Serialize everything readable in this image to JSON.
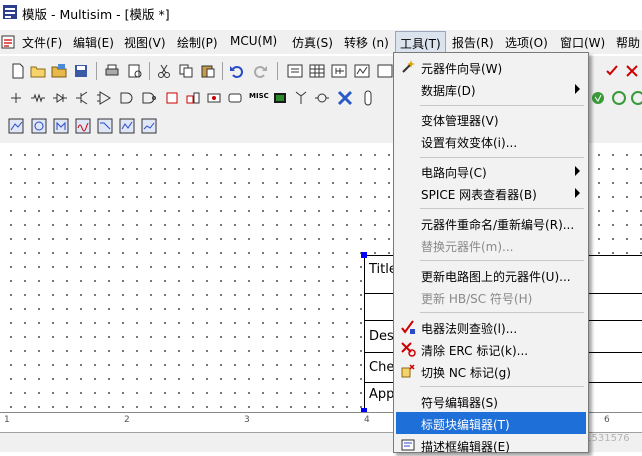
{
  "window": {
    "title": "模版 - Multisim - [模版 *]"
  },
  "menubar": {
    "items": [
      {
        "label": "文件(F)",
        "active": false
      },
      {
        "label": "编辑(E)",
        "active": false
      },
      {
        "label": "视图(V)",
        "active": false
      },
      {
        "label": "绘制(P)",
        "active": false
      },
      {
        "label": "MCU(M)",
        "active": false
      },
      {
        "label": "仿真(S)",
        "active": false
      },
      {
        "label": "转移 (n)",
        "active": false
      },
      {
        "label": "工具(T)",
        "active": true
      },
      {
        "label": "报告(R)",
        "active": false
      },
      {
        "label": "选项(O)",
        "active": false
      },
      {
        "label": "窗口(W)",
        "active": false
      },
      {
        "label": "帮助",
        "active": false
      }
    ]
  },
  "toolbar": {
    "misc_label": "MISC"
  },
  "tools_menu": {
    "items": [
      {
        "label": "元器件向导(W)",
        "disabled": false,
        "submenu": false,
        "icon": "component-wizard-icon"
      },
      {
        "label": "数据库(D)",
        "disabled": false,
        "submenu": true
      },
      {
        "label": "变体管理器(V)",
        "disabled": false,
        "submenu": false
      },
      {
        "label": "设置有效变体(i)...",
        "disabled": false,
        "submenu": false
      },
      {
        "label": "电路向导(C)",
        "disabled": false,
        "submenu": true
      },
      {
        "label": "SPICE 网表查看器(B)",
        "disabled": false,
        "submenu": true
      },
      {
        "label": "元器件重命名/重新编号(R)...",
        "disabled": false,
        "submenu": false
      },
      {
        "label": "替换元器件(m)...",
        "disabled": true,
        "submenu": false
      },
      {
        "label": "更新电路图上的元器件(U)...",
        "disabled": false,
        "submenu": false
      },
      {
        "label": "更新 HB/SC 符号(H)",
        "disabled": true,
        "submenu": false
      },
      {
        "label": "电器法则查验(l)...",
        "disabled": false,
        "submenu": false,
        "icon": "erc-check-icon"
      },
      {
        "label": "清除 ERC 标记(k)...",
        "disabled": false,
        "submenu": false,
        "icon": "clear-erc-icon"
      },
      {
        "label": "切换 NC 标记(g)",
        "disabled": false,
        "submenu": false,
        "icon": "toggle-nc-icon"
      },
      {
        "label": "符号编辑器(S)",
        "disabled": false,
        "submenu": false
      },
      {
        "label": "标题块编辑器(T)",
        "disabled": false,
        "submenu": false,
        "highlighted": true
      },
      {
        "label": "描述框编辑器(E)",
        "disabled": false,
        "submenu": false,
        "icon": "description-box-icon"
      }
    ]
  },
  "title_block": {
    "rows": [
      "Title",
      "Des",
      "Che",
      "App"
    ]
  },
  "ruler": {
    "marks": [
      "1",
      "2",
      "3",
      "4",
      "6"
    ]
  },
  "watermark": "CSDN @t2e1531576",
  "colors": {
    "highlight": "#1f6fd8",
    "handle": "#0000ff"
  }
}
